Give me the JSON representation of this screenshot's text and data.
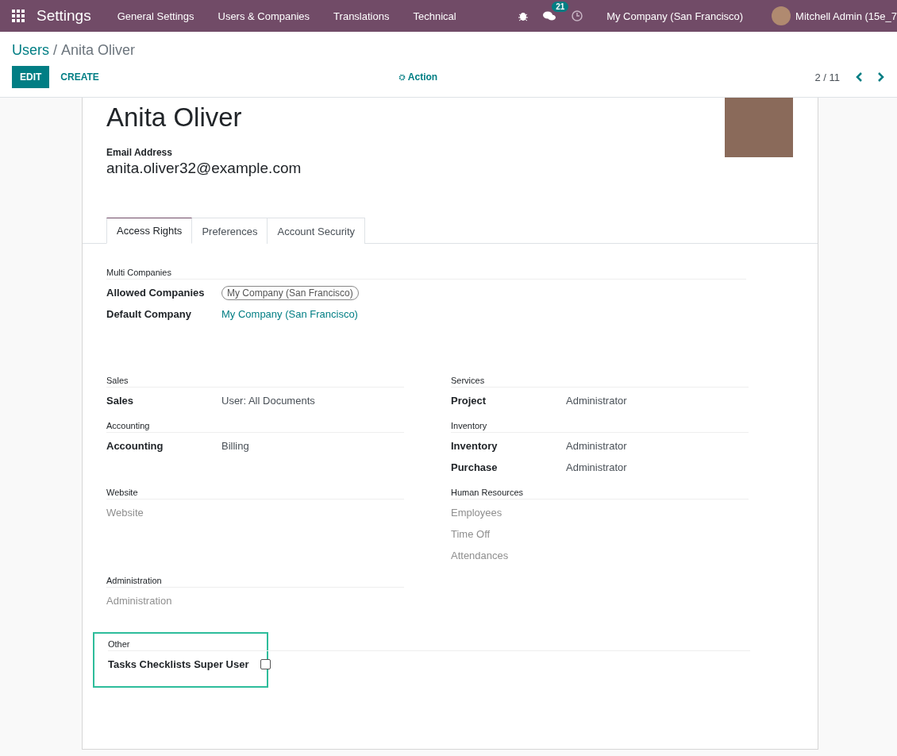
{
  "navbar": {
    "brand": "Settings",
    "menu": [
      "General Settings",
      "Users & Companies",
      "Translations",
      "Technical"
    ],
    "messages_badge": "21",
    "company": "My Company (San Francisco)",
    "user": "Mitchell Admin (15e_7"
  },
  "breadcrumb": {
    "parent": "Users",
    "separator": "/",
    "current": "Anita Oliver"
  },
  "buttons": [
    {
      "label": "EDIT",
      "kind": "primary"
    },
    {
      "label": "CREATE",
      "kind": "secondary"
    }
  ],
  "action": "Action",
  "pager": "2 / 11",
  "record": {
    "name": "Anita Oliver",
    "email_label": "Email Address",
    "email": "anita.oliver32@example.com"
  },
  "tabs": [
    {
      "label": "Access Rights",
      "selected": true
    },
    {
      "label": "Preferences",
      "selected": false
    },
    {
      "label": "Account Security",
      "selected": false
    }
  ],
  "multi_companies": {
    "title": "Multi Companies",
    "fields": [
      {
        "label": "Allowed Companies",
        "kind": "tag",
        "value": "My Company (San Francisco)"
      },
      {
        "label": "Default Company",
        "kind": "link",
        "value": "My Company (San Francisco)"
      }
    ]
  },
  "groups": [
    {
      "title": "Sales",
      "fields": [
        {
          "label": "Sales",
          "kind": "select",
          "value": "User: All Documents"
        }
      ]
    },
    {
      "title": "Services",
      "fields": [
        {
          "label": "Project",
          "kind": "select",
          "value": "Administrator"
        }
      ]
    },
    {
      "title": "Accounting",
      "fields": [
        {
          "label": "Accounting",
          "kind": "select",
          "value": "Billing"
        }
      ]
    },
    {
      "title": "Inventory",
      "fields": [
        {
          "label": "Inventory",
          "kind": "select",
          "value": "Administrator"
        },
        {
          "label": "Purchase",
          "kind": "select",
          "value": "Administrator"
        }
      ]
    },
    {
      "title": "Website",
      "fields": [
        {
          "label": "Website",
          "kind": "disabled"
        }
      ]
    },
    {
      "title": "Human Resources",
      "fields": [
        {
          "label": "Employees",
          "kind": "disabled"
        },
        {
          "label": "Time Off",
          "kind": "disabled"
        },
        {
          "label": "Attendances",
          "kind": "disabled"
        }
      ]
    },
    {
      "title": "Administration",
      "fields": [
        {
          "label": "Administration",
          "kind": "disabled"
        }
      ]
    }
  ],
  "other": {
    "title": "Other",
    "highlighted": true,
    "fields": [
      {
        "label": "Tasks Checklists Super User",
        "kind": "checkbox",
        "checked": false
      }
    ]
  }
}
